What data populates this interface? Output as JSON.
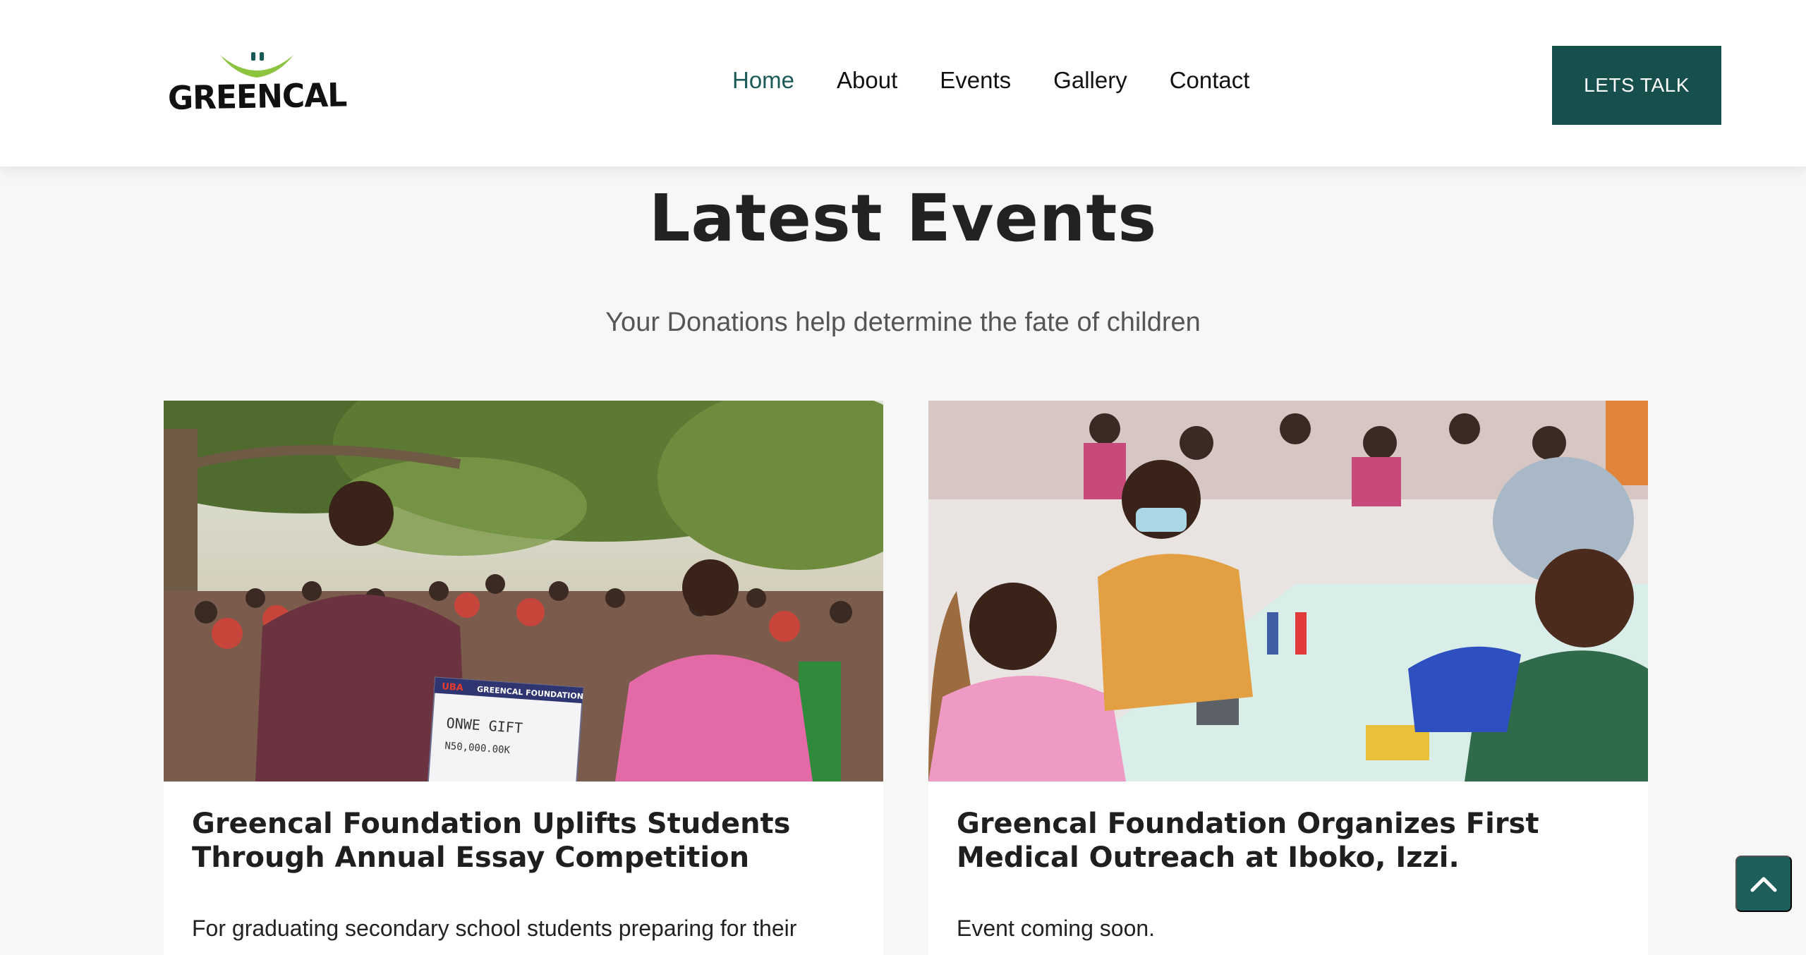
{
  "header": {
    "logo_text": "GREENCAL",
    "nav": [
      {
        "label": "Home",
        "active": true
      },
      {
        "label": "About",
        "active": false
      },
      {
        "label": "Events",
        "active": false
      },
      {
        "label": "Gallery",
        "active": false
      },
      {
        "label": "Contact",
        "active": false
      }
    ],
    "cta_label": "LETS TALK"
  },
  "section": {
    "title": "Latest Events",
    "subtitle": "Your Donations help determine the fate of children"
  },
  "events": [
    {
      "title": "Greencal Foundation Uplifts Students Through Annual Essay Competition",
      "text": "For graduating secondary school students preparing for their",
      "image_icon": "photo-students-cheque",
      "cheque": {
        "bank": "UBA",
        "org": "GREENCAL FOUNDATION",
        "payee": "ONWE GIFT",
        "amount": "N50,000.00K"
      }
    },
    {
      "title": "Greencal Foundation Organizes First Medical Outreach at Iboko, Izzi.",
      "text": "Event coming soon.",
      "image_icon": "photo-medical-outreach"
    }
  ],
  "colors": {
    "brand": "#174f4c",
    "nav_active": "#1b5a57",
    "logo_green": "#8cc43f"
  },
  "scroll_top_icon": "chevron-up-icon"
}
